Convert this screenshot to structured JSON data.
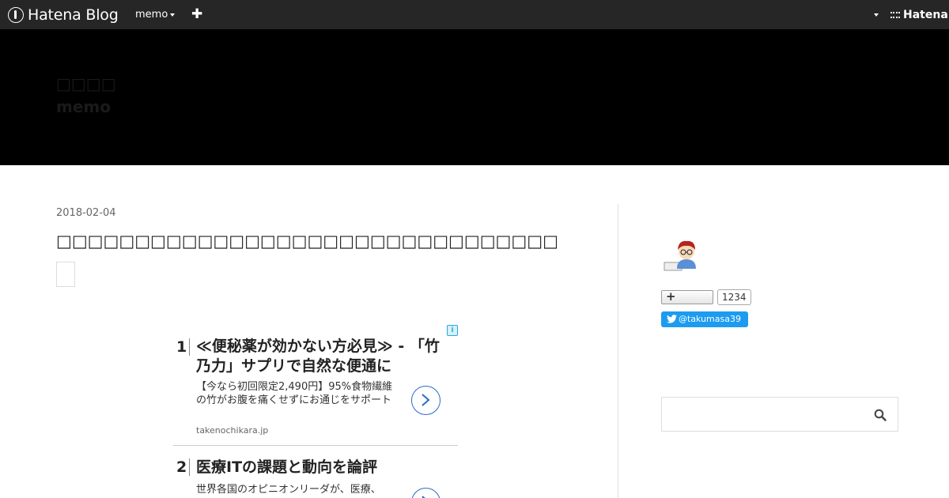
{
  "topbar": {
    "logo_text": "Hatena Blog",
    "blog_menu": "memo",
    "add_label": "✚",
    "hatena_label": "Hatena"
  },
  "header": {
    "title": "□□□□",
    "description": "memo"
  },
  "entry": {
    "date": "2018-02-04",
    "title": "□□□□□□□□□□□□□□□□□□□□□□□□□□□□□□□□"
  },
  "ad": {
    "info_icon": "i",
    "items": [
      {
        "num": "1",
        "headline": "≪便秘薬が効かない方必見≫ - 「竹乃力」サプリで自然な便通に",
        "body": "【今なら初回限定2,490円】95%食物繊維の竹がお腹を痛くせずにお通じをサポート",
        "domain": "takenochikara.jp"
      },
      {
        "num": "2",
        "headline": "医療ITの課題と動向を論評",
        "body": "世界各国のオピニオンリーダが、医療、"
      }
    ]
  },
  "sidebar": {
    "bookmark_count": "1234",
    "twitter_handle": "@takumasa39",
    "search_placeholder": ""
  },
  "colors": {
    "topbar": "#262626",
    "header_bg": "#000000",
    "twitter": "#1d9bf0",
    "ad_link": "#2a6bc9"
  }
}
